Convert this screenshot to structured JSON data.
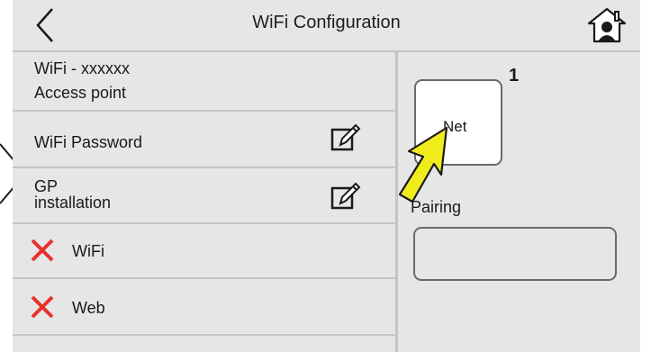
{
  "header": {
    "title": "WiFi Configuration",
    "back_icon": "chevron-left",
    "home_icon": "home-user"
  },
  "menu": {
    "access_point": {
      "line1": "WiFi - xxxxxx",
      "line2": "Access point"
    },
    "wifi_password": {
      "label": "WiFi Password",
      "icon": "edit-pencil"
    },
    "gp_installation": {
      "line1": "GP",
      "line2": "installation",
      "icon": "edit-pencil"
    },
    "wifi": {
      "label": "WiFi",
      "status_icon": "red-x"
    },
    "web": {
      "label": "Web",
      "status_icon": "red-x"
    }
  },
  "right": {
    "net_button": {
      "label": "Net",
      "badge": "1"
    },
    "pairing": {
      "label": "Pairing",
      "value": ""
    }
  },
  "colors": {
    "background": "#e6e6e6",
    "divider": "#c4c4c4",
    "error_x": "#e8312c",
    "annotation_arrow": "#f0ec1c"
  }
}
